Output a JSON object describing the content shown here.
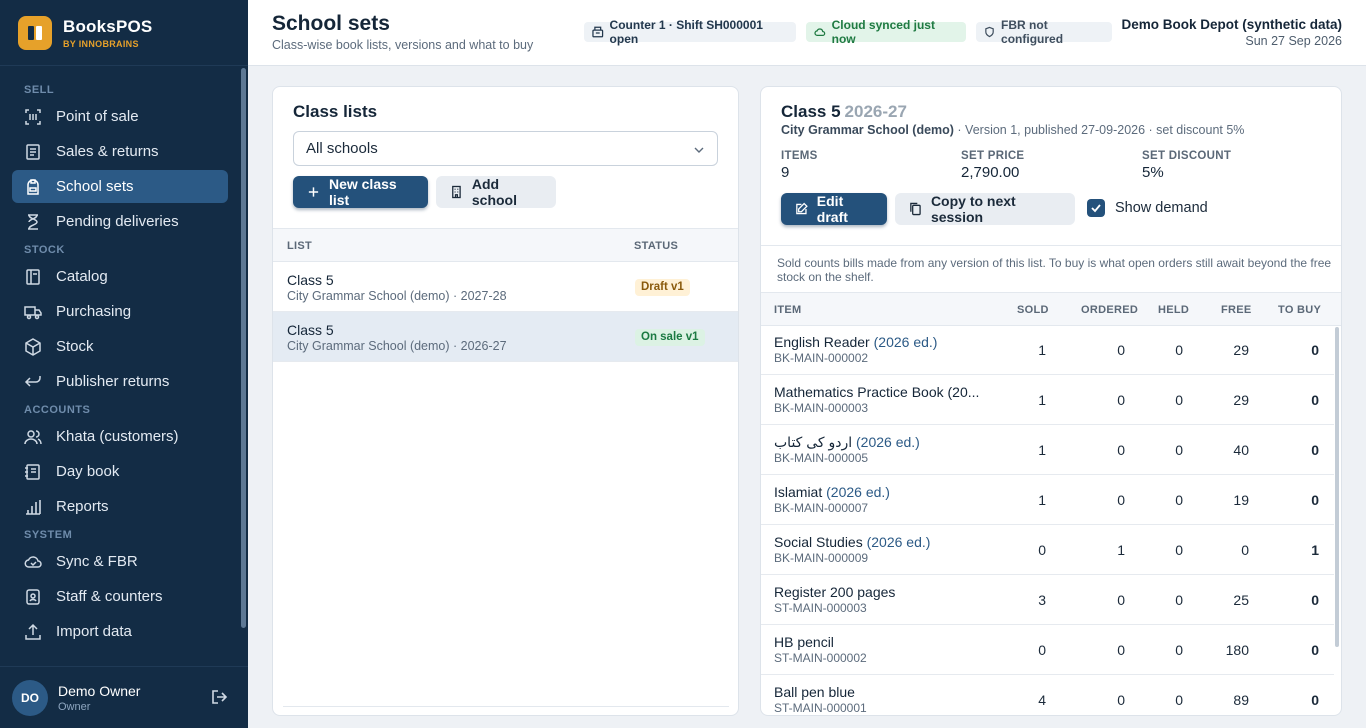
{
  "brand": {
    "name": "BooksPOS",
    "sub": "BY INNOBRAINS"
  },
  "sidebar": {
    "sections": [
      {
        "title": "SELL",
        "items": [
          {
            "label": "Point of sale",
            "icon": "barcode-icon"
          },
          {
            "label": "Sales & returns",
            "icon": "receipt-icon"
          },
          {
            "label": "School sets",
            "icon": "backpack-icon",
            "active": true
          },
          {
            "label": "Pending deliveries",
            "icon": "hourglass-icon"
          }
        ]
      },
      {
        "title": "STOCK",
        "items": [
          {
            "label": "Catalog",
            "icon": "book-icon"
          },
          {
            "label": "Purchasing",
            "icon": "truck-icon"
          },
          {
            "label": "Stock",
            "icon": "box-icon"
          },
          {
            "label": "Publisher returns",
            "icon": "return-arrow-icon"
          }
        ]
      },
      {
        "title": "ACCOUNTS",
        "items": [
          {
            "label": "Khata (customers)",
            "icon": "users-icon"
          },
          {
            "label": "Day book",
            "icon": "notebook-icon"
          },
          {
            "label": "Reports",
            "icon": "bar-chart-icon"
          }
        ]
      },
      {
        "title": "SYSTEM",
        "items": [
          {
            "label": "Sync & FBR",
            "icon": "cloud-icon"
          },
          {
            "label": "Staff & counters",
            "icon": "badge-icon"
          },
          {
            "label": "Import data",
            "icon": "upload-icon"
          }
        ]
      }
    ],
    "user": {
      "initials": "DO",
      "name": "Demo Owner",
      "role": "Owner"
    }
  },
  "header": {
    "title": "School sets",
    "subtitle": "Class-wise book lists, versions and what to buy",
    "counter_chip": "Counter 1 · Shift SH000001 open",
    "cloud_chip": "Cloud synced just now",
    "fbr_chip": "FBR not configured",
    "org_name": "Demo Book Depot (synthetic data)",
    "date": "Sun 27 Sep 2026"
  },
  "class_lists": {
    "title": "Class lists",
    "school_filter": "All schools",
    "new_button": "New class list",
    "add_school_button": "Add school",
    "columns": {
      "list": "LIST",
      "status": "STATUS"
    },
    "rows": [
      {
        "title": "Class 5",
        "sub": "City Grammar School (demo) · 2027-28",
        "status": "Draft v1"
      },
      {
        "title": "Class 5",
        "sub": "City Grammar School (demo) · 2026-27",
        "status": "On sale v1"
      }
    ]
  },
  "detail": {
    "title": "Class 5",
    "session": "2026-27",
    "school": "City Grammar School (demo)",
    "meta": " · Version 1, published 27-09-2026 · set discount 5%",
    "stats": [
      {
        "label": "ITEMS",
        "value": "9"
      },
      {
        "label": "SET PRICE",
        "value": "2,790.00"
      },
      {
        "label": "SET DISCOUNT",
        "value": "5%"
      }
    ],
    "edit_button": "Edit draft",
    "copy_button": "Copy to next session",
    "show_demand_label": "Show demand",
    "show_demand_checked": true,
    "note": "Sold counts bills made from any version of this list. To buy is what open orders still await beyond the free stock on the shelf.",
    "columns": {
      "item": "ITEM",
      "sold": "SOLD",
      "ordered": "ORDERED",
      "held": "HELD",
      "free": "FREE",
      "to_buy": "TO BUY"
    },
    "items": [
      {
        "name": "English Reader",
        "edition": "(2026 ed.)",
        "sku": "BK-MAIN-000002",
        "sold": "1",
        "ordered": "0",
        "held": "0",
        "free": "29",
        "to_buy": "0"
      },
      {
        "name": "Mathematics Practice Book (20...",
        "edition": "",
        "sku": "BK-MAIN-000003",
        "sold": "1",
        "ordered": "0",
        "held": "0",
        "free": "29",
        "to_buy": "0"
      },
      {
        "name": "اردو کی کتاب",
        "edition": "(2026 ed.)",
        "sku": "BK-MAIN-000005",
        "sold": "1",
        "ordered": "0",
        "held": "0",
        "free": "40",
        "to_buy": "0"
      },
      {
        "name": "Islamiat",
        "edition": "(2026 ed.)",
        "sku": "BK-MAIN-000007",
        "sold": "1",
        "ordered": "0",
        "held": "0",
        "free": "19",
        "to_buy": "0"
      },
      {
        "name": "Social Studies",
        "edition": "(2026 ed.)",
        "sku": "BK-MAIN-000009",
        "sold": "0",
        "ordered": "1",
        "held": "0",
        "free": "0",
        "to_buy": "1"
      },
      {
        "name": "Register 200 pages",
        "edition": "",
        "sku": "ST-MAIN-000003",
        "sold": "3",
        "ordered": "0",
        "held": "0",
        "free": "25",
        "to_buy": "0"
      },
      {
        "name": "HB pencil",
        "edition": "",
        "sku": "ST-MAIN-000002",
        "sold": "0",
        "ordered": "0",
        "held": "0",
        "free": "180",
        "to_buy": "0"
      },
      {
        "name": "Ball pen blue",
        "edition": "",
        "sku": "ST-MAIN-000001",
        "sold": "4",
        "ordered": "0",
        "held": "0",
        "free": "89",
        "to_buy": "0"
      }
    ]
  },
  "colors": {
    "sidebar_bg": "#132c45",
    "active_nav": "#2c5a86",
    "primary": "#24517b",
    "brand_accent": "#e6a12a",
    "success": "#1f7a42",
    "draft": "#8a5a0c"
  }
}
